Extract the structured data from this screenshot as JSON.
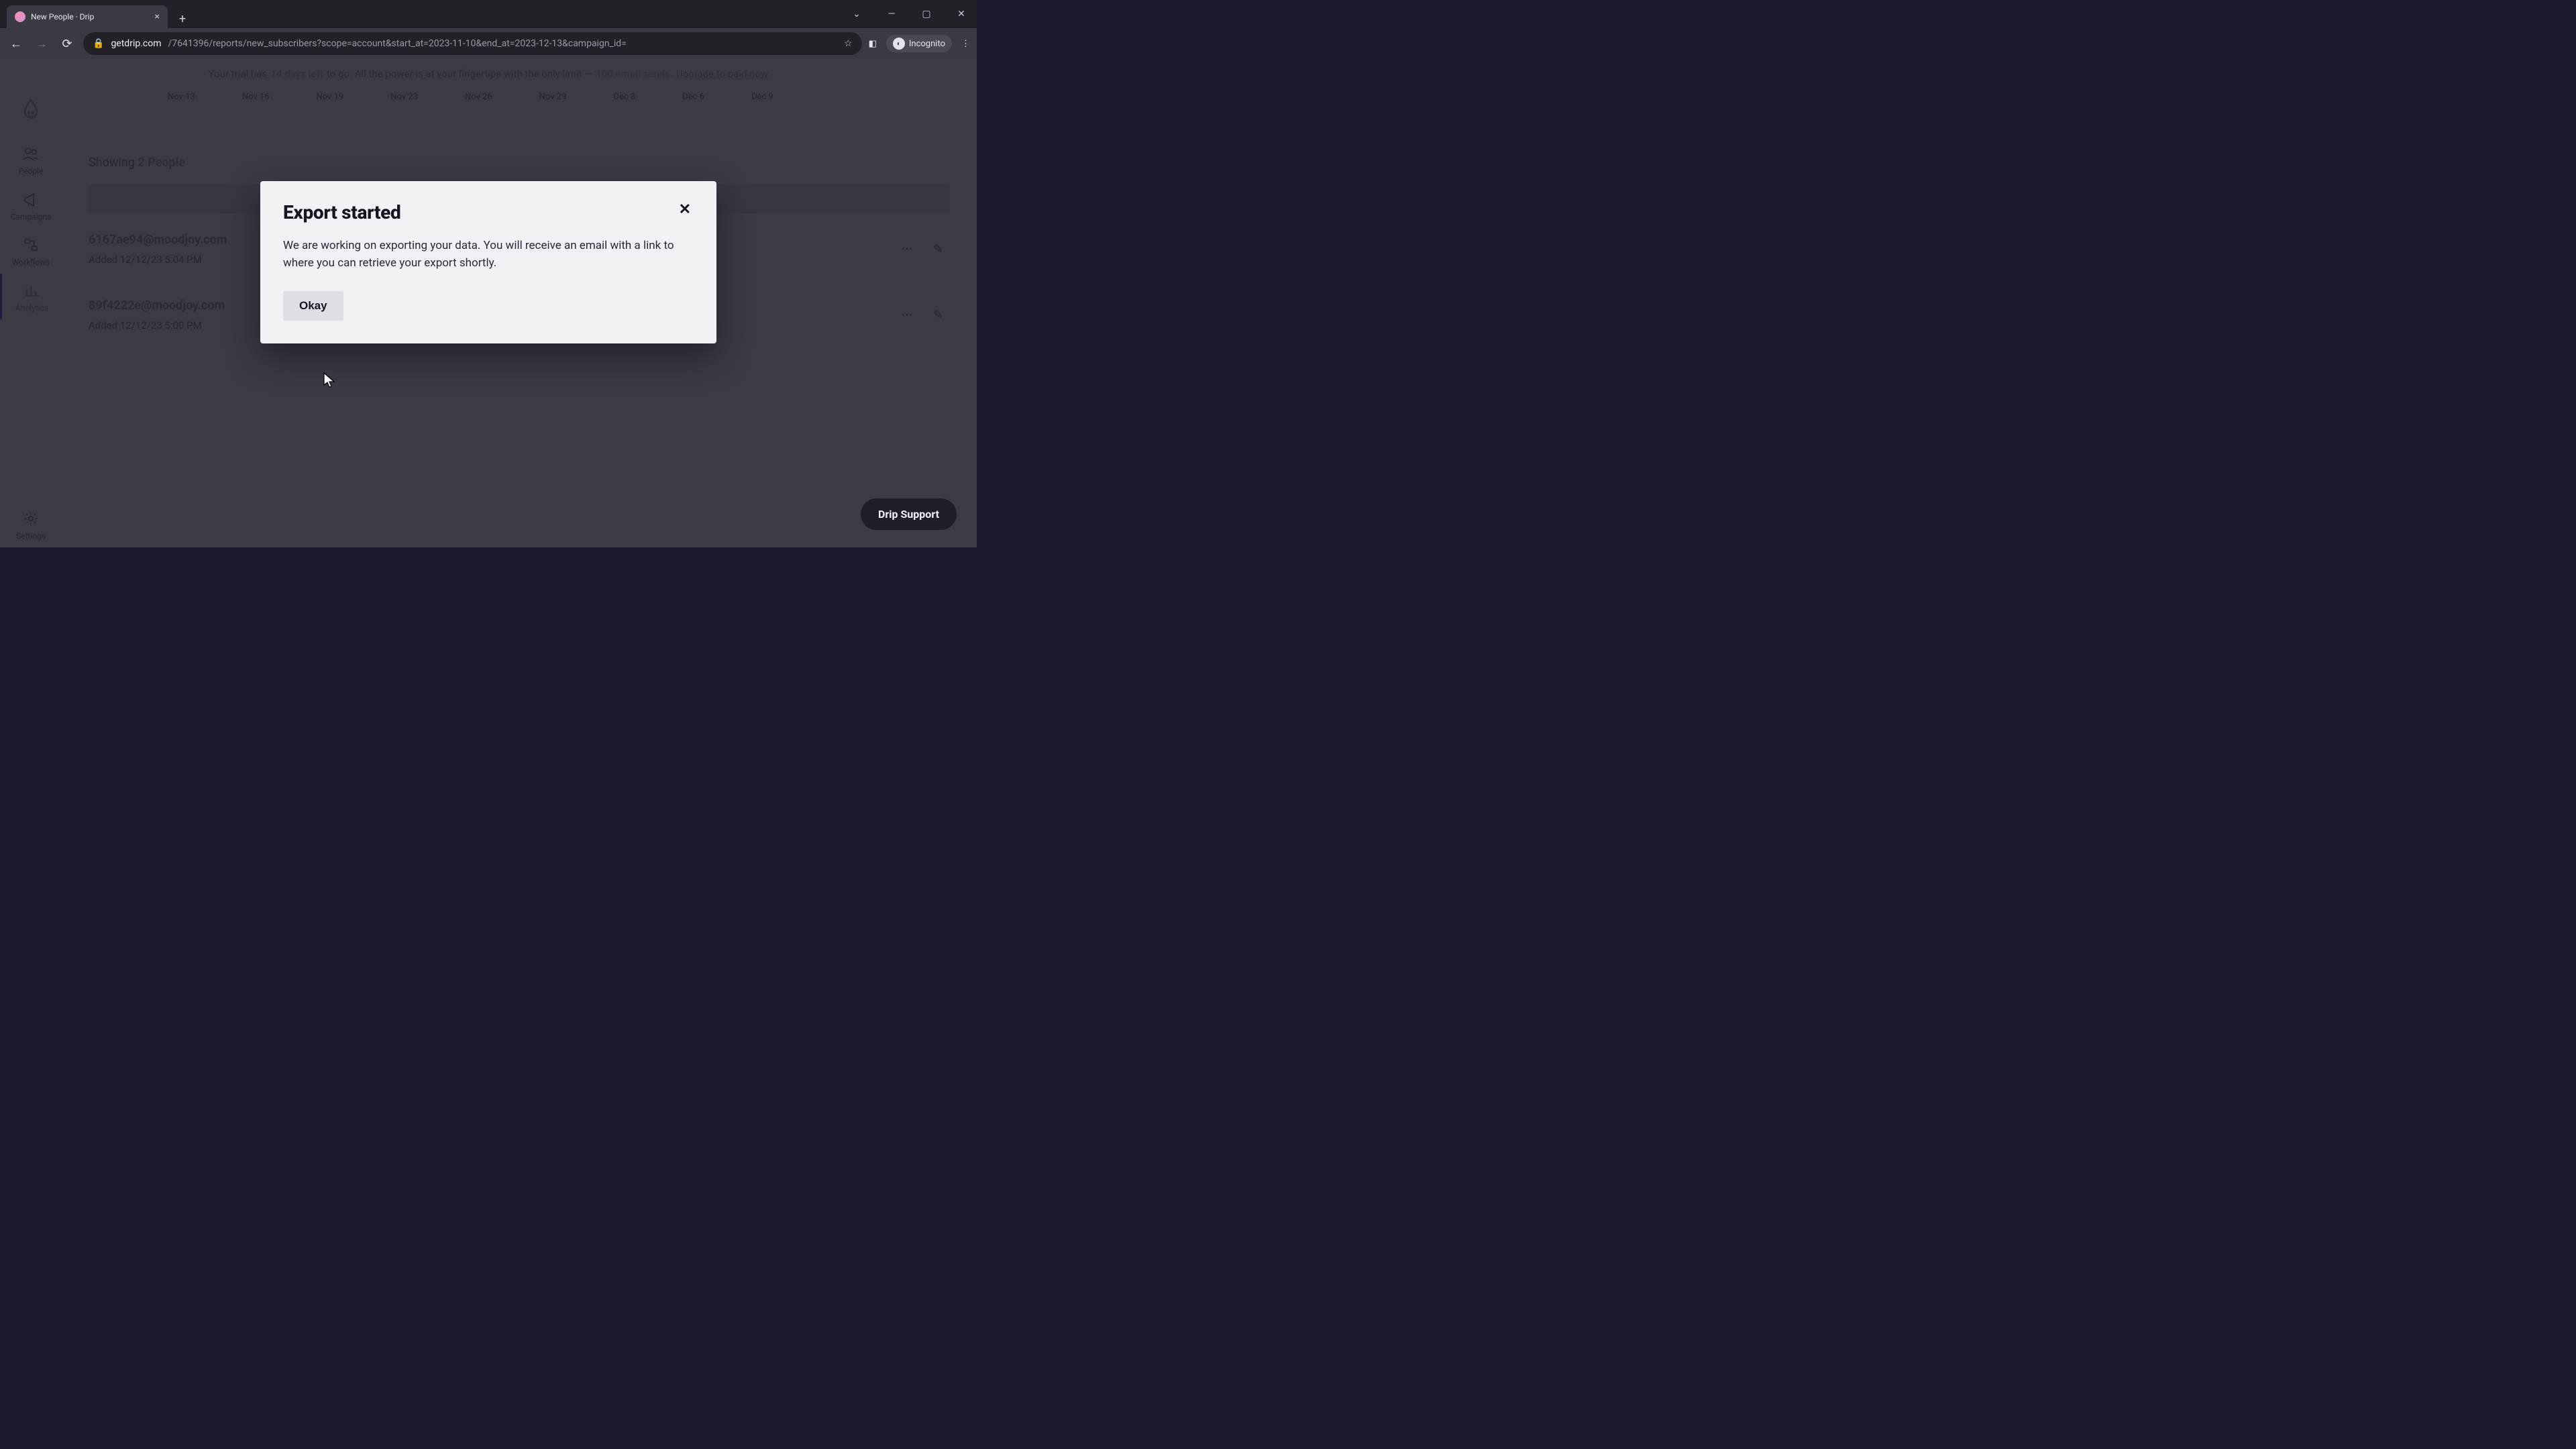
{
  "browser": {
    "tab_title": "New People · Drip",
    "url_host": "getdrip.com",
    "url_path": "/7641396/reports/new_subscribers?scope=account&start_at=2023-11-10&end_at=2023-12-13&campaign_id=",
    "incognito_label": "Incognito"
  },
  "trial_banner": {
    "prefix": "Your trial has ",
    "days": "14 days left",
    "middle": " to go. All the power is at your fingertips with the only limit — ",
    "limit": "100 email sends.",
    "cta": "Upgrade to paid now"
  },
  "sidebar": {
    "items": [
      {
        "label": "People"
      },
      {
        "label": "Campaigns"
      },
      {
        "label": "Workflows"
      },
      {
        "label": "Analytics"
      },
      {
        "label": "Settings"
      }
    ]
  },
  "dates": [
    "Nov 13",
    "Nov 16",
    "Nov 19",
    "Nov 23",
    "Nov 26",
    "Nov 29",
    "Dec 3",
    "Dec 6",
    "Dec 9"
  ],
  "list": {
    "showing_prefix": "Showing ",
    "showing_count": "2 People",
    "rows": [
      {
        "email": "6167ae94@moodjoy.com",
        "added": "Added 12/12/23 5:04 PM"
      },
      {
        "email": "89f4222e@moodjoy.com",
        "added": "Added 12/12/23 5:00 PM"
      }
    ]
  },
  "support_label": "Drip Support",
  "modal": {
    "title": "Export started",
    "body": "We are working on exporting your data. You will receive an email with a link to where you can retrieve your export shortly.",
    "ok": "Okay",
    "close": "✕"
  }
}
